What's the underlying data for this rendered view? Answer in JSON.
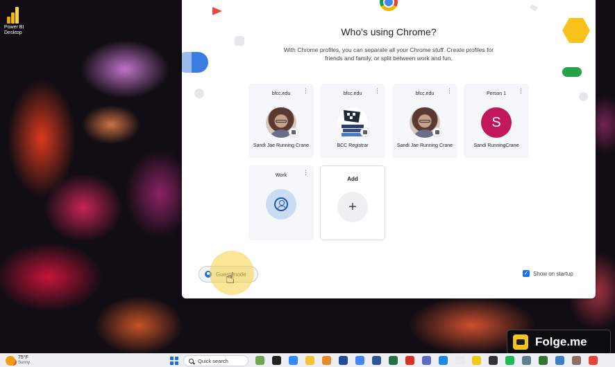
{
  "desktop": {
    "icons": [
      {
        "label": "Power BI Desktop",
        "icon": "power-bi-icon"
      }
    ]
  },
  "chrome_picker": {
    "title": "Who's using Chrome?",
    "subtitle": "With Chrome profiles, you can separate all your Chrome stuff. Create profiles for friends and family, or split between work and fun.",
    "profiles": [
      {
        "label": "bfcc.edu",
        "name": "Sandi Jae Running Crane",
        "avatar": "photo",
        "managed": true
      },
      {
        "label": "bfcc.edu",
        "name": "BCC Registrar",
        "avatar": "registrar-logo",
        "managed": true
      },
      {
        "label": "bfcc.edu",
        "name": "Sandi Jae Running Crane",
        "avatar": "photo",
        "managed": true
      },
      {
        "label": "Person 1",
        "name": "Sandi RunningCrane",
        "avatar": "letter",
        "avatar_letter": "S",
        "avatar_color": "#c2185b"
      },
      {
        "label": "Work",
        "name": "",
        "avatar": "person-icon"
      }
    ],
    "menu_glyph": "⋮",
    "add": {
      "label": "Add",
      "glyph": "+"
    },
    "guest": {
      "label": "Guest mode"
    },
    "show_on_startup": {
      "label": "Show on startup",
      "checked": true
    }
  },
  "watermark": {
    "text": "Folge.me"
  },
  "taskbar": {
    "weather": {
      "temp": "75°F",
      "condition": "Sunny"
    },
    "search": {
      "label": "Quick search"
    },
    "pinned_icons": [
      {
        "name": "minecraft-icon",
        "color": "#6aa84f"
      },
      {
        "name": "terminal-icon",
        "color": "#222222"
      },
      {
        "name": "zoom-icon",
        "color": "#2d8cff"
      },
      {
        "name": "file-explorer-icon",
        "color": "#f4c430"
      },
      {
        "name": "photos-icon",
        "color": "#e58a2a"
      },
      {
        "name": "j1-icon",
        "color": "#1f4e9c"
      },
      {
        "name": "chrome-icon",
        "color": "#4285f4"
      },
      {
        "name": "word-icon",
        "color": "#2b579a"
      },
      {
        "name": "excel-icon",
        "color": "#217346"
      },
      {
        "name": "acrobat-icon",
        "color": "#d93025"
      },
      {
        "name": "calculator-icon",
        "color": "#5c6bc0"
      },
      {
        "name": "remote-desktop-icon",
        "color": "#1e88e5"
      },
      {
        "name": "stack-icon",
        "color": "#e8eaed"
      },
      {
        "name": "power-bi-icon",
        "color": "#f2c811"
      },
      {
        "name": "sticky-icon",
        "color": "#333333"
      },
      {
        "name": "spotify-icon",
        "color": "#1db954"
      },
      {
        "name": "network-icon",
        "color": "#607d8b"
      },
      {
        "name": "project-icon",
        "color": "#31752f"
      },
      {
        "name": "photo-viewer-icon",
        "color": "#3b82c4"
      },
      {
        "name": "game-icon",
        "color": "#8d6e63"
      },
      {
        "name": "chrome-profile-icon",
        "color": "#ea4335"
      }
    ]
  },
  "colors": {
    "accent": "#1a73e8",
    "highlight": "#f5d246"
  }
}
